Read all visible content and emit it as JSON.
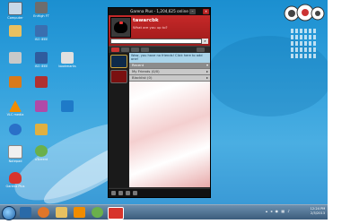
{
  "desktop_icons": [
    {
      "label": "Computer",
      "icon": "computer-icon",
      "color": "#c8d8e8"
    },
    {
      "label": "EnHigh FT",
      "icon": "app-icon",
      "color": "#6d6d6d"
    },
    {
      "label": "",
      "icon": "folder-icon",
      "color": "#e8c060"
    },
    {
      "label": "ISO IEEE",
      "icon": "document-icon",
      "color": "#3a6fb0"
    },
    {
      "label": "",
      "icon": "recycle-bin-icon",
      "color": "#c9c9c9"
    },
    {
      "label": "ISO IEEE",
      "icon": "document-icon",
      "color": "#2f5c9e"
    },
    {
      "label": "bookmarks",
      "icon": "document-icon",
      "color": "#e0e0e0"
    },
    {
      "label": "",
      "icon": "music-icon",
      "color": "#d97a1a"
    },
    {
      "label": "",
      "icon": "image-icon",
      "color": "#b03030"
    },
    {
      "label": "VLC media",
      "icon": "vlc-icon",
      "color": "#f08c00"
    },
    {
      "label": "",
      "icon": "video-icon",
      "color": "#b04aa8"
    },
    {
      "label": "",
      "icon": "app-icon",
      "color": "#1e7ac8"
    },
    {
      "label": "",
      "icon": "chat-icon",
      "color": "#2a70c8"
    },
    {
      "label": "",
      "icon": "folder-icon",
      "color": "#e0b040"
    },
    {
      "label": "Notepad",
      "icon": "notepad-icon",
      "color": "#f0f0f0"
    },
    {
      "label": "uTorrent",
      "icon": "utorrent-icon",
      "color": "#6ab04c"
    },
    {
      "label": "Garena Plus",
      "icon": "garena-icon",
      "color": "#d8342c"
    }
  ],
  "garena": {
    "title": "Garena Plus - 1,204,625 online",
    "username": "tawarcbk",
    "status": "What are you up to?",
    "search_placeholder": "",
    "notice": "Wow, you have no friends! Click here to add one!",
    "sections": [
      {
        "label": "Recent"
      },
      {
        "label": "My Friends (0/0)"
      },
      {
        "label": "Blacklist (0)"
      }
    ]
  },
  "clock": {
    "time": "12:24 PM",
    "date": "2/3/2013"
  },
  "colors": {
    "garena_red": "#c62828",
    "notice": "#a9d4ea"
  }
}
